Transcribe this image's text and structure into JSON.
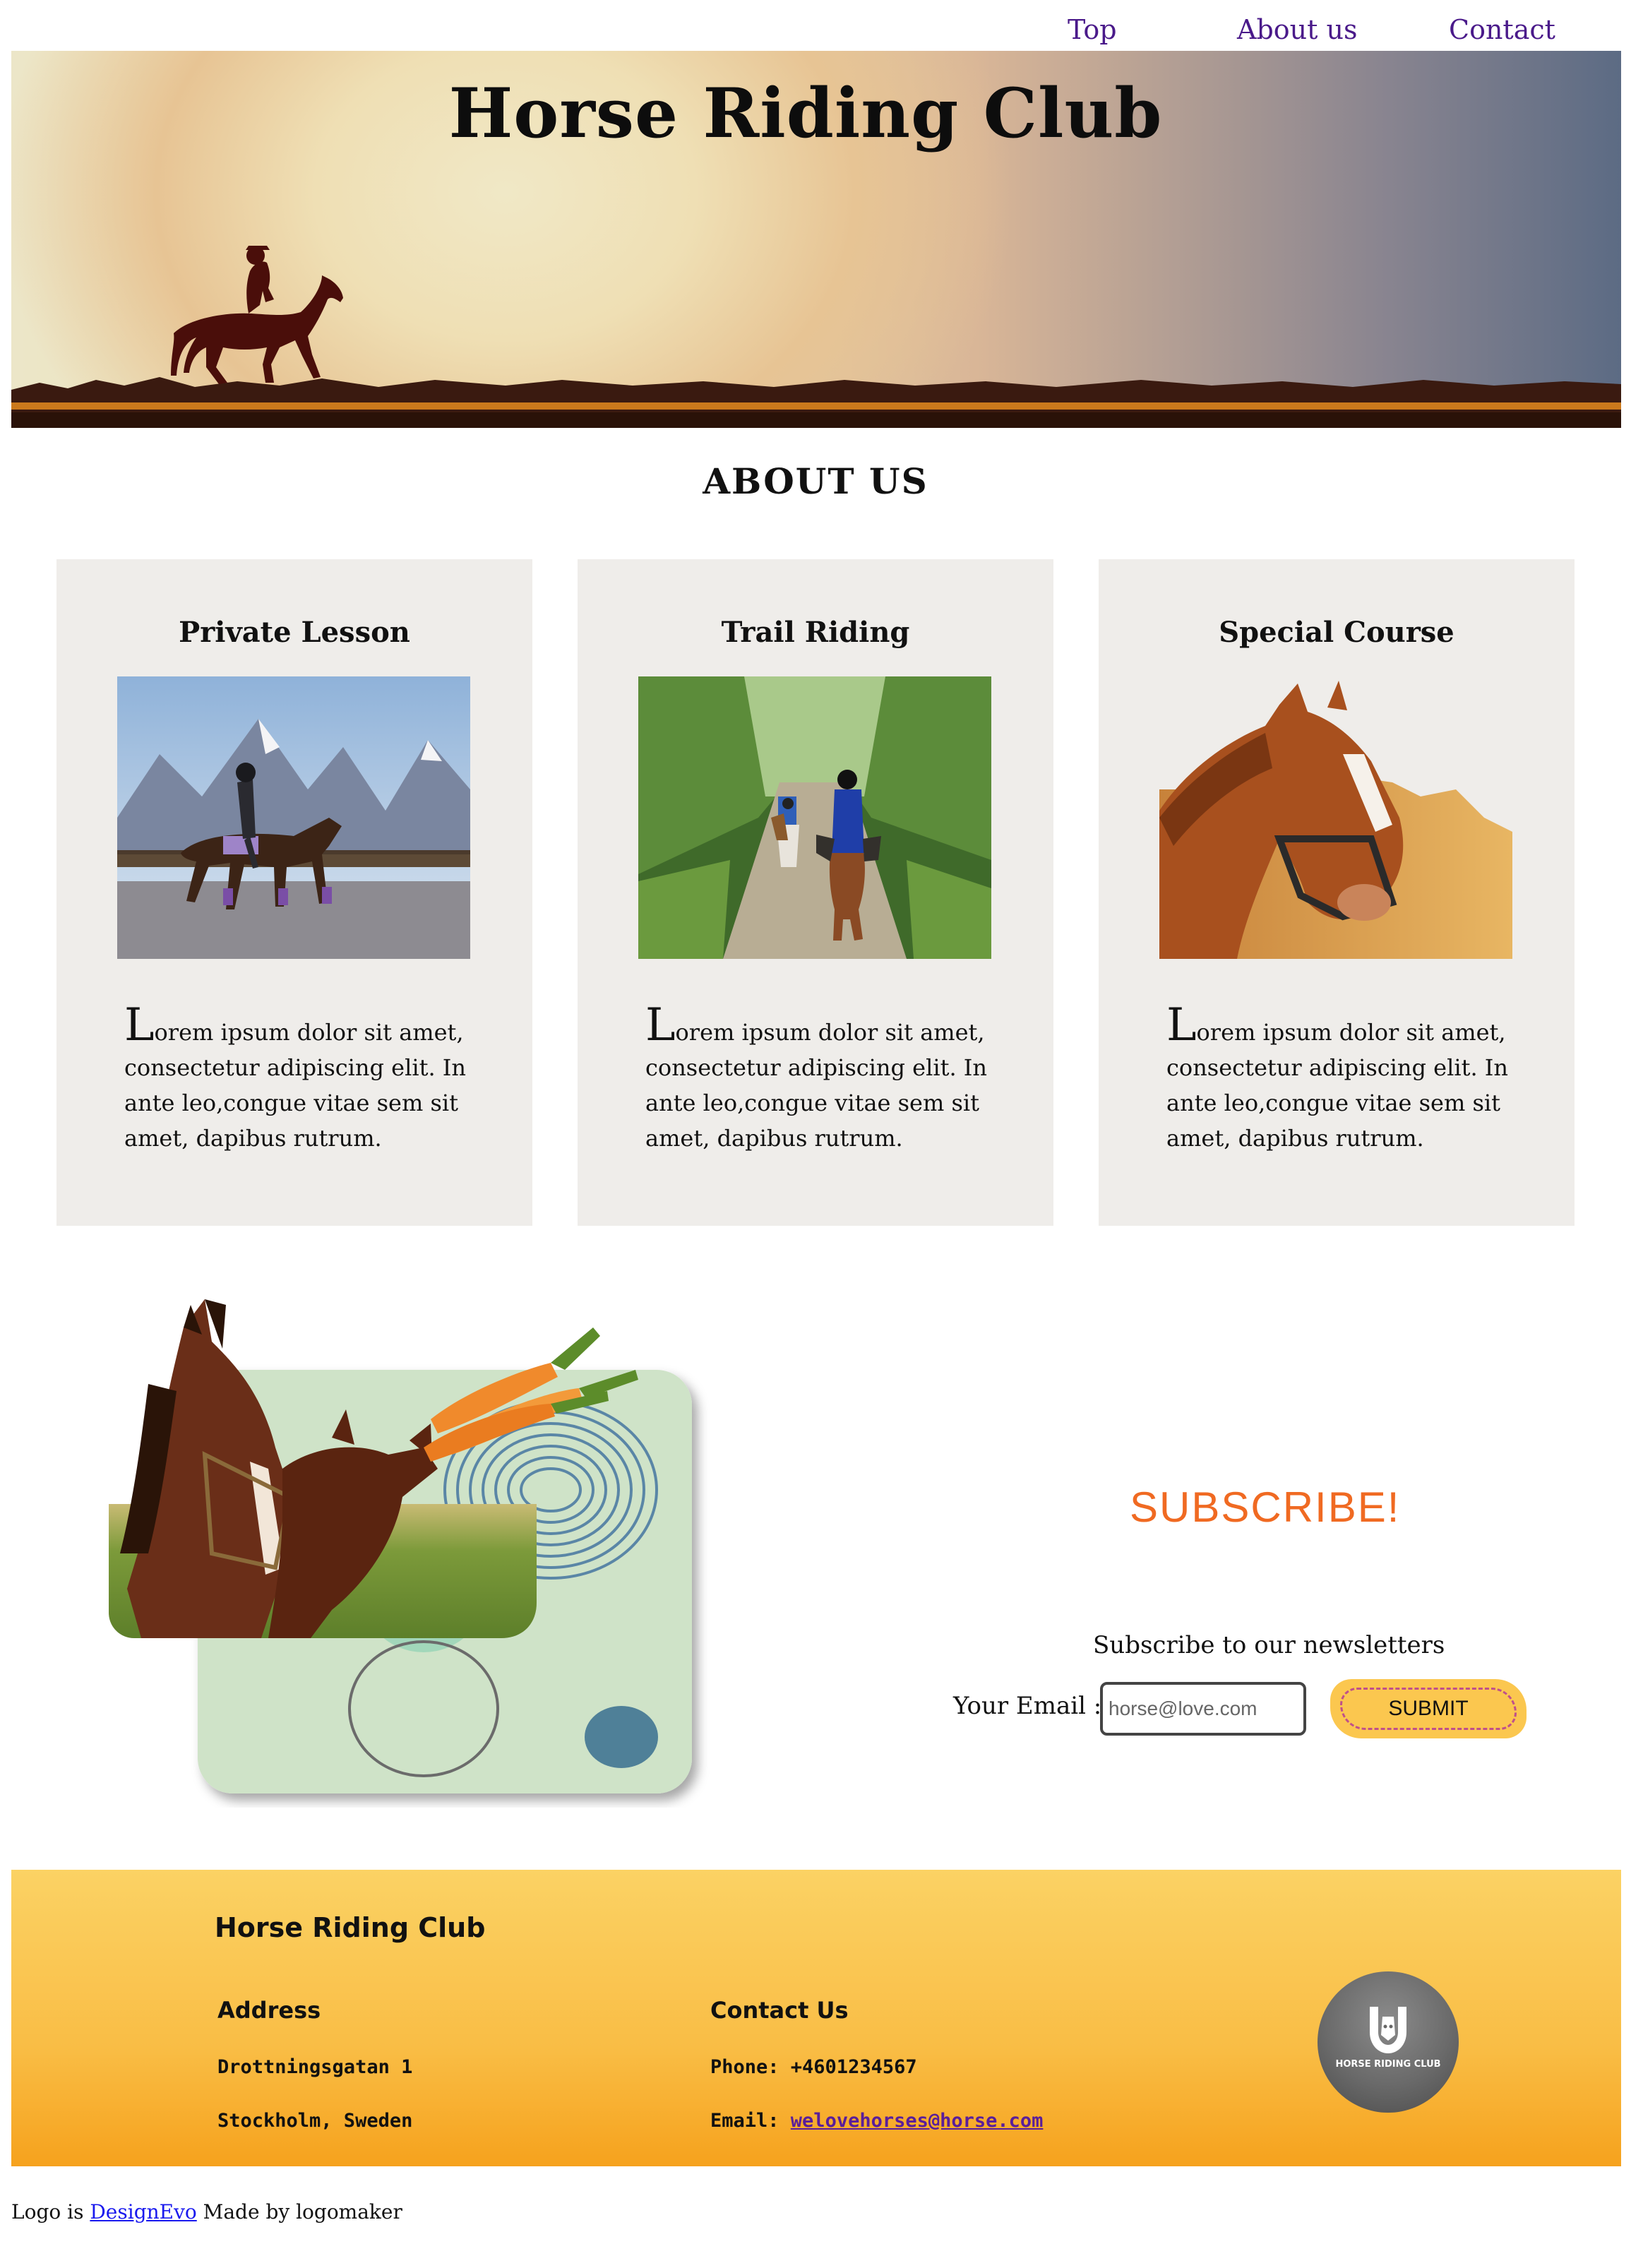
{
  "nav": {
    "items": [
      "Top",
      "About us",
      "Contact"
    ]
  },
  "hero": {
    "title": "Horse Riding Club"
  },
  "about": {
    "title": "ABOUT US",
    "cards": [
      {
        "title": "Private Lesson",
        "first_letter": "L",
        "text": "orem ipsum dolor sit amet, consectetur adipiscing elit. In ante leo,congue vitae sem sit amet, dapibus rutrum."
      },
      {
        "title": "Trail Riding",
        "first_letter": "L",
        "text": "orem ipsum dolor sit amet, consectetur adipiscing elit. In ante leo,congue vitae sem sit amet, dapibus rutrum."
      },
      {
        "title": "Special Course",
        "first_letter": "L",
        "text": "orem ipsum dolor sit amet, consectetur adipiscing elit. In ante leo,congue vitae sem sit amet, dapibus rutrum."
      }
    ]
  },
  "subscribe": {
    "heading": "SUBSCRIBE!",
    "newsletter": "Subscribe to our newsletters",
    "email_label": "Your Email :",
    "email_placeholder": "horse@love.com",
    "submit_label": "SUBMIT"
  },
  "footer": {
    "brand": "Horse Riding Club",
    "address_heading": "Address",
    "address_line1": "Drottningsgatan 1",
    "address_line2": "Stockholm, Sweden",
    "contact_heading": "Contact Us",
    "phone": "Phone: +4601234567",
    "email_prefix": "Email: ",
    "email": "welovehorses@horse.com",
    "logo_text": "HORSE RIDING CLUB"
  },
  "credit": {
    "prefix": "Logo is ",
    "link": "DesignEvo",
    "suffix": " Made by logomaker"
  },
  "colors": {
    "nav_link": "#4a1a8a",
    "subscribe": "#f06a22",
    "submit_bg": "#fbc74f",
    "footer_top": "#fbd264",
    "footer_bottom": "#f6a21d",
    "card_bg": "#efedea"
  }
}
